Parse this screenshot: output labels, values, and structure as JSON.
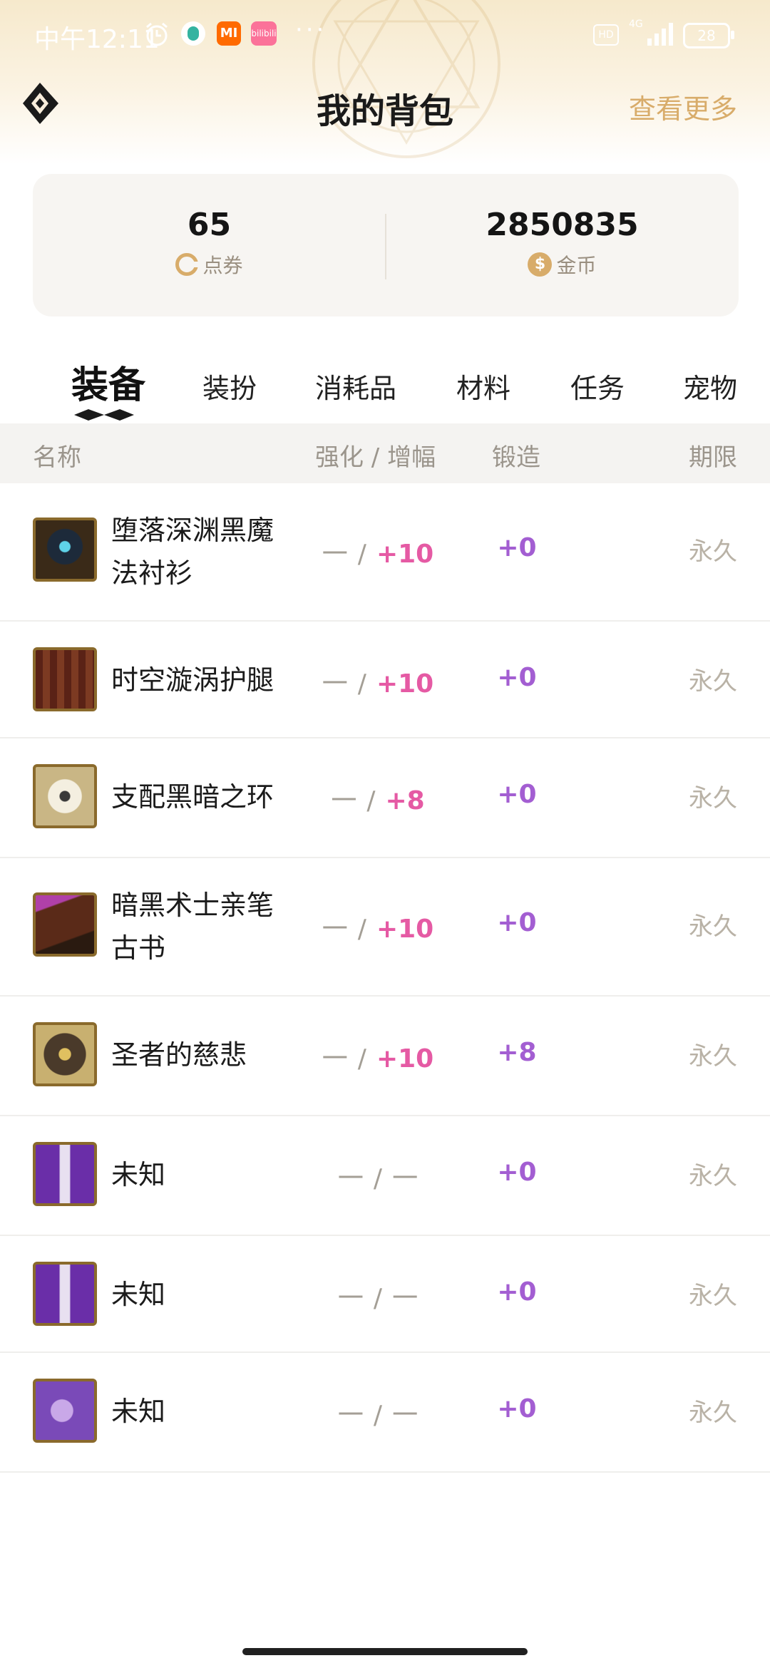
{
  "status_bar": {
    "time": "中午12:11",
    "mi_label": "MI",
    "bili_label": "bilibili",
    "network_hd": "HD",
    "network_type": "4G",
    "battery": "28"
  },
  "header": {
    "title": "我的背包",
    "more_link": "查看更多"
  },
  "wallet": {
    "coupons": {
      "amount": "65",
      "label": "点券"
    },
    "gold": {
      "amount": "2850835",
      "label": "金币",
      "icon_glyph": "$"
    }
  },
  "tabs": [
    {
      "label": "装备",
      "active": true
    },
    {
      "label": "装扮",
      "active": false
    },
    {
      "label": "消耗品",
      "active": false
    },
    {
      "label": "材料",
      "active": false
    },
    {
      "label": "任务",
      "active": false
    },
    {
      "label": "宠物",
      "active": false
    }
  ],
  "table": {
    "columns": {
      "name": "名称",
      "upgrade": "强化 / 增幅",
      "forge": "锻造",
      "period": "期限"
    },
    "rows": [
      {
        "name": "堕落深渊黑魔法衬衫",
        "enhance": "一",
        "amplify": "+10",
        "forge": "+0",
        "period": "永久",
        "icon": "dark-armor-icon"
      },
      {
        "name": "时空漩涡护腿",
        "enhance": "一",
        "amplify": "+10",
        "forge": "+0",
        "period": "永久",
        "icon": "leggings-icon"
      },
      {
        "name": "支配黑暗之环",
        "enhance": "一",
        "amplify": "+8",
        "forge": "+0",
        "period": "永久",
        "icon": "ring-icon"
      },
      {
        "name": "暗黑术士亲笔古书",
        "enhance": "一",
        "amplify": "+10",
        "forge": "+0",
        "period": "永久",
        "icon": "tome-icon"
      },
      {
        "name": "圣者的慈悲",
        "enhance": "一",
        "amplify": "+10",
        "forge": "+8",
        "period": "永久",
        "icon": "holy-weapon-icon"
      },
      {
        "name": "未知",
        "enhance": "一",
        "amplify": "一",
        "forge": "+0",
        "period": "永久",
        "icon": "purple-sword-icon"
      },
      {
        "name": "未知",
        "enhance": "一",
        "amplify": "一",
        "forge": "+0",
        "period": "永久",
        "icon": "purple-sword-icon"
      },
      {
        "name": "未知",
        "enhance": "一",
        "amplify": "一",
        "forge": "+0",
        "period": "永久",
        "icon": "purple-moon-icon"
      }
    ]
  },
  "colors": {
    "accent_gold": "#d8ac6a",
    "amplify_pink": "#e55aa4",
    "forge_purple": "#a35ed2",
    "period_gray": "#b9b2a6"
  }
}
